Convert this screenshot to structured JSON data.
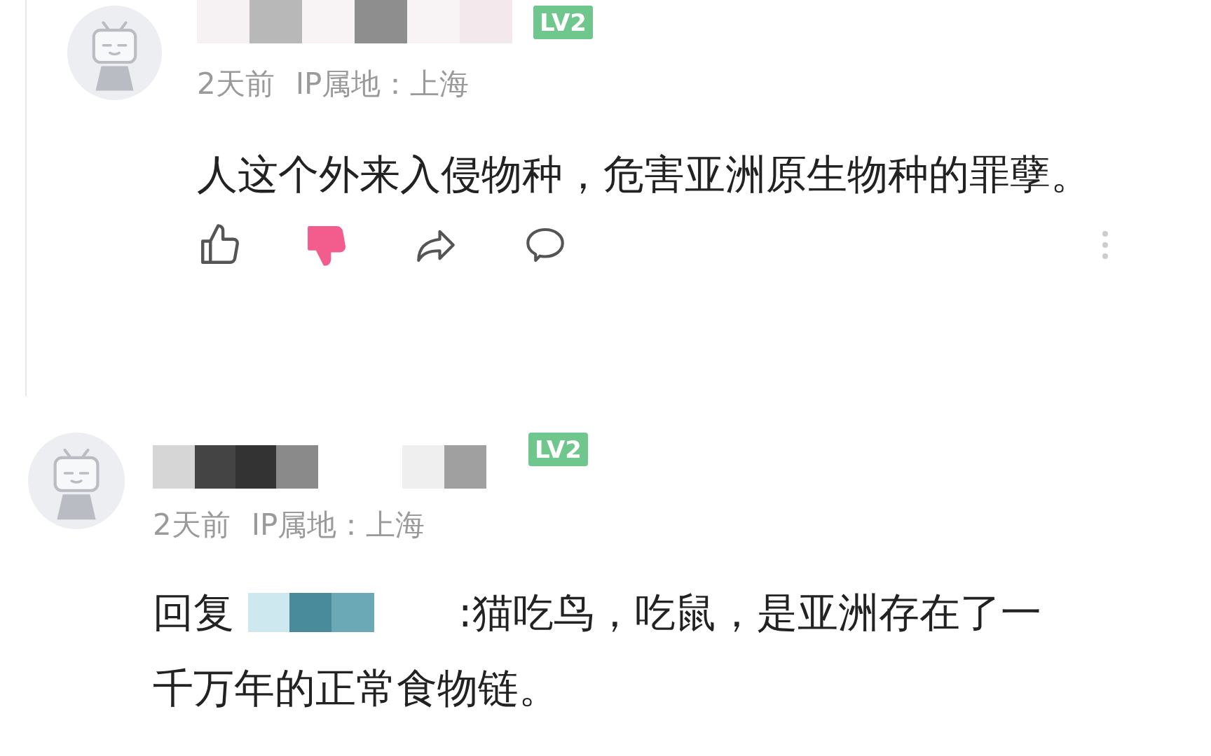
{
  "comments": [
    {
      "level_badge": "LV2",
      "time": "2天前",
      "ip": "IP属地：上海",
      "text": "人这个外来入侵物种，危害亚洲原生物种的罪孽。",
      "actions": {
        "liked": false,
        "disliked": true
      }
    },
    {
      "level_badge": "LV2",
      "time": "2天前",
      "ip": "IP属地：上海",
      "reply_prefix": "回复",
      "text_lines": [
        ":猫吃鸟，吃鼠，是亚洲存在了一",
        "千万年的正常食物链。"
      ]
    }
  ]
}
